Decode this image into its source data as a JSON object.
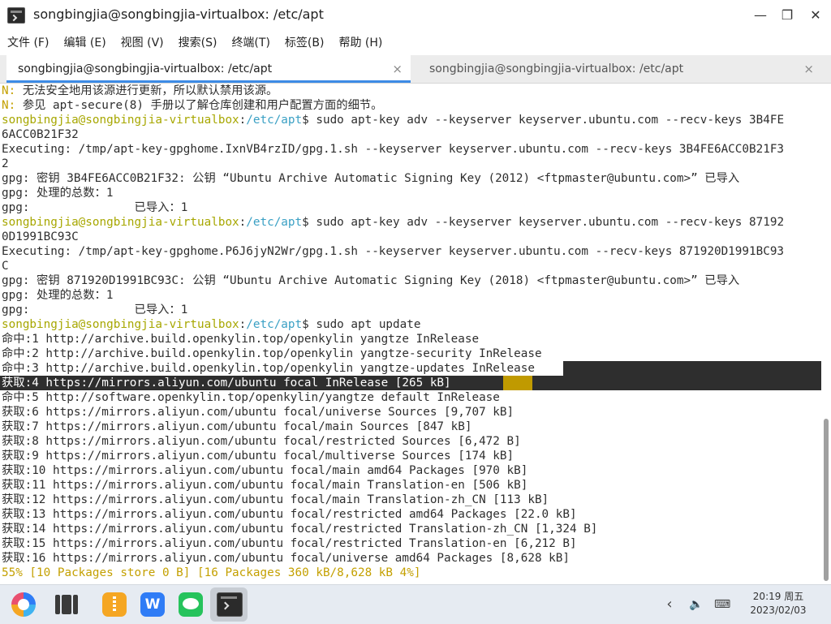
{
  "window": {
    "title": "songbingjia@songbingjia-virtualbox: /etc/apt",
    "minimize_glyph": "—",
    "maximize_glyph": "❐",
    "close_glyph": "✕"
  },
  "menu": [
    "文件 (F)",
    "编辑 (E)",
    "视图 (V)",
    "搜索(S)",
    "终端(T)",
    "标签(B)",
    "帮助 (H)"
  ],
  "tabs": [
    {
      "label": "songbingjia@songbingjia-virtualbox: /etc/apt",
      "close": "×"
    },
    {
      "label": "songbingjia@songbingjia-virtualbox: /etc/apt",
      "close": "×"
    }
  ],
  "prompt": {
    "user": "songbingjia@songbingjia-virtualbox",
    "sep": ":",
    "path": "/etc/apt",
    "suffix": "$ "
  },
  "terminal": {
    "notes": [
      {
        "prefix": "N:",
        "text": " 无法安全地用该源进行更新，所以默认禁用该源。"
      },
      {
        "prefix": "N:",
        "text": " 参见 apt-secure(8) 手册以了解仓库创建和用户配置方面的细节。"
      }
    ],
    "cmd1": "sudo apt-key adv --keyserver keyserver.ubuntu.com --recv-keys 3B4FE",
    "cmd1_wrap": "6ACC0B21F32",
    "exec1": "Executing: /tmp/apt-key-gpghome.IxnVB4rzID/gpg.1.sh --keyserver keyserver.ubuntu.com --recv-keys 3B4FE6ACC0B21F3",
    "exec1_wrap": "2",
    "gpg1_a": "gpg: 密钥 3B4FE6ACC0B21F32: 公钥 “Ubuntu Archive Automatic Signing Key (2012) <ftpmaster@ubuntu.com>” 已导入",
    "gpg1_b": "gpg: 处理的总数：1",
    "gpg1_c": "gpg:               已导入：1",
    "cmd2": "sudo apt-key adv --keyserver keyserver.ubuntu.com --recv-keys 87192",
    "cmd2_wrap": "0D1991BC93C",
    "exec2": "Executing: /tmp/apt-key-gpghome.P6J6jyN2Wr/gpg.1.sh --keyserver keyserver.ubuntu.com --recv-keys 871920D1991BC93",
    "exec2_wrap": "C",
    "gpg2_a": "gpg: 密钥 871920D1991BC93C: 公钥 “Ubuntu Archive Automatic Signing Key (2018) <ftpmaster@ubuntu.com>” 已导入",
    "gpg2_b": "gpg: 处理的总数：1",
    "gpg2_c": "gpg:               已导入：1",
    "cmd3": "sudo apt update",
    "apt_lines": [
      "命中:1 http://archive.build.openkylin.top/openkylin yangtze InRelease",
      "命中:2 http://archive.build.openkylin.top/openkylin yangtze-security InRelease",
      "命中:3 http://archive.build.openkylin.top/openkylin yangtze-updates InRelease",
      "获取:4 https://mirrors.aliyun.com/ubuntu focal InRelease [265 kB]",
      "命中:5 http://software.openkylin.top/openkylin/yangtze default InRelease",
      "获取:6 https://mirrors.aliyun.com/ubuntu focal/universe Sources [9,707 kB]",
      "获取:7 https://mirrors.aliyun.com/ubuntu focal/main Sources [847 kB]",
      "获取:8 https://mirrors.aliyun.com/ubuntu focal/restricted Sources [6,472 B]",
      "获取:9 https://mirrors.aliyun.com/ubuntu focal/multiverse Sources [174 kB]",
      "获取:10 https://mirrors.aliyun.com/ubuntu focal/main amd64 Packages [970 kB]",
      "获取:11 https://mirrors.aliyun.com/ubuntu focal/main Translation-en [506 kB]",
      "获取:12 https://mirrors.aliyun.com/ubuntu focal/main Translation-zh_CN [113 kB]",
      "获取:13 https://mirrors.aliyun.com/ubuntu focal/restricted amd64 Packages [22.0 kB]",
      "获取:14 https://mirrors.aliyun.com/ubuntu focal/restricted Translation-zh_CN [1,324 B]",
      "获取:15 https://mirrors.aliyun.com/ubuntu focal/restricted Translation-en [6,212 B]",
      "获取:16 https://mirrors.aliyun.com/ubuntu focal/universe amd64 Packages [8,628 kB]"
    ],
    "progress": "55% [10 Packages store 0 B] [16 Packages 360 kB/8,628 kB 4%]"
  },
  "taskbar": {
    "wps_label": "W",
    "tray": {
      "chevron": "‹",
      "volume": "🔈",
      "keyboard": "⌨"
    },
    "time": "20:19 周五",
    "date": "2023/02/03"
  },
  "colors": {
    "prompt_user": "#a7a700",
    "prompt_path": "#3aa0c4",
    "note_prefix": "#c4a000",
    "progress": "#c4a000",
    "active_tab_indicator": "#3d8be6"
  },
  "icons": [
    "terminal-app-icon",
    "minimize-icon",
    "maximize-icon",
    "close-icon",
    "tab-close-icon",
    "start-menu-icon",
    "multitask-view-icon",
    "file-manager-icon",
    "wps-office-icon",
    "wechat-icon",
    "terminal-taskbar-icon",
    "chevron-left-icon",
    "volume-icon",
    "keyboard-icon"
  ]
}
